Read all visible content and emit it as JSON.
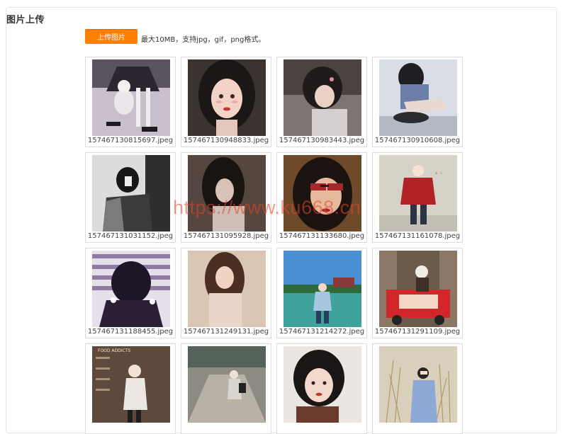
{
  "page": {
    "title": "图片上传"
  },
  "upload": {
    "button_label": "上传图片",
    "hint": "最大10MB，支持jpg，gif，png格式。",
    "accent": "#ff7f00"
  },
  "watermark": "https://www.ku668.cn",
  "images": [
    {
      "filename": "157467130815697.jpeg"
    },
    {
      "filename": "157467130948833.jpeg"
    },
    {
      "filename": "157467130983443.jpeg"
    },
    {
      "filename": "157467130910608.jpeg"
    },
    {
      "filename": "157467131031152.jpeg"
    },
    {
      "filename": "157467131095928.jpeg"
    },
    {
      "filename": "157467131133680.jpeg"
    },
    {
      "filename": "157467131161078.jpeg"
    },
    {
      "filename": "157467131188455.jpeg"
    },
    {
      "filename": "157467131249131.jpeg"
    },
    {
      "filename": "157467131214272.jpeg"
    },
    {
      "filename": "157467131291109.jpeg"
    },
    {
      "filename": ""
    },
    {
      "filename": ""
    },
    {
      "filename": ""
    },
    {
      "filename": ""
    }
  ]
}
